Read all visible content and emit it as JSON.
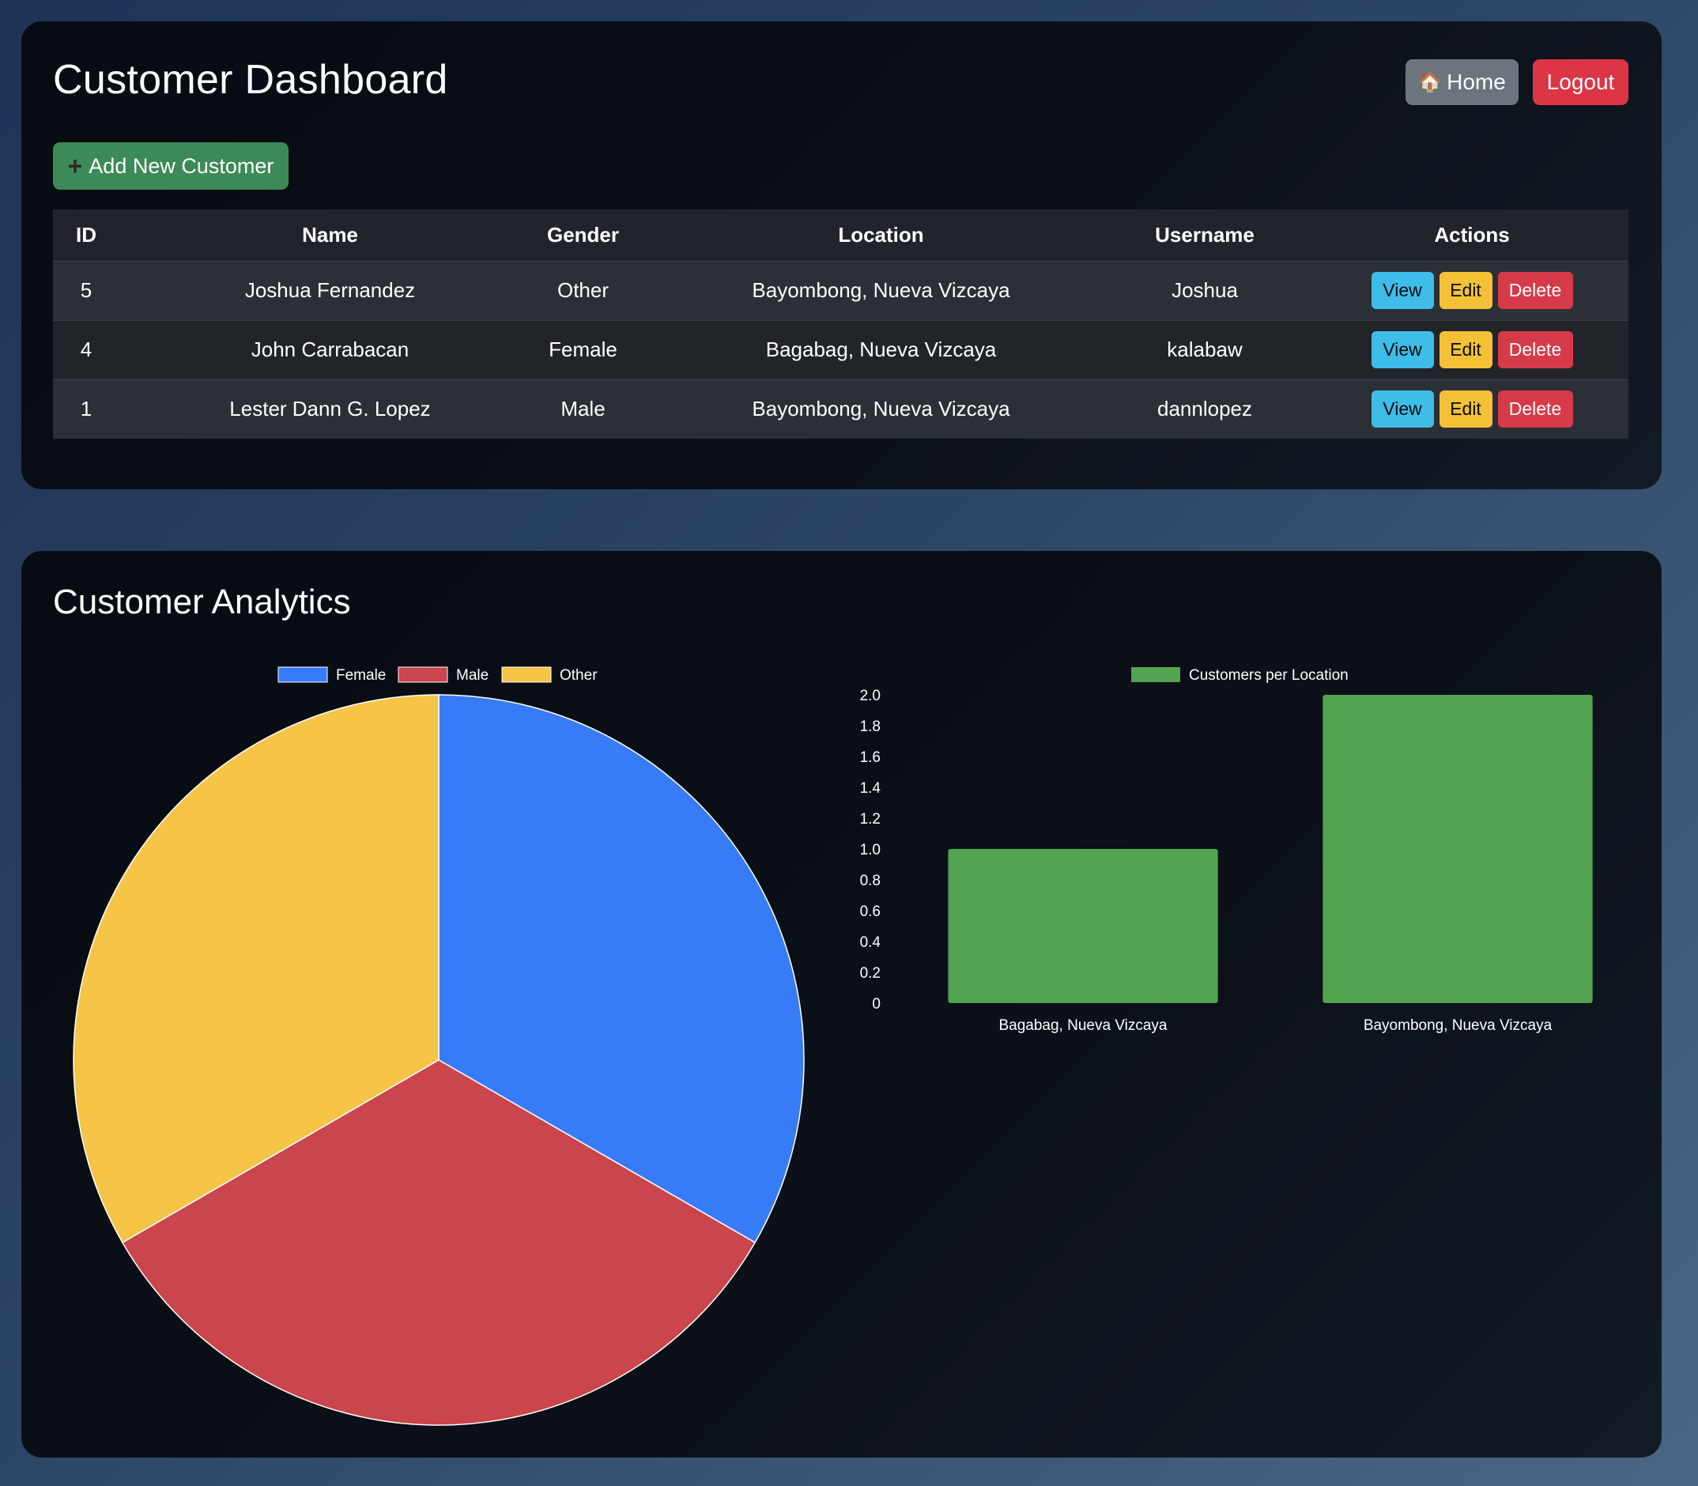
{
  "dashboard": {
    "title": "Customer Dashboard",
    "home_label": "Home",
    "home_icon": "🏠",
    "logout_label": "Logout",
    "add_label": "Add New Customer",
    "add_icon": "+"
  },
  "table": {
    "headers": [
      "ID",
      "Name",
      "Gender",
      "Location",
      "Username",
      "Actions"
    ],
    "action_labels": {
      "view": "View",
      "edit": "Edit",
      "delete": "Delete"
    },
    "rows": [
      {
        "id": "5",
        "name": "Joshua Fernandez",
        "gender": "Other",
        "location": "Bayombong, Nueva Vizcaya",
        "username": "Joshua"
      },
      {
        "id": "4",
        "name": "John Carrabacan",
        "gender": "Female",
        "location": "Bagabag, Nueva Vizcaya",
        "username": "kalabaw"
      },
      {
        "id": "1",
        "name": "Lester Dann G. Lopez",
        "gender": "Male",
        "location": "Bayombong, Nueva Vizcaya",
        "username": "dannlopez"
      }
    ]
  },
  "analytics": {
    "title": "Customer Analytics"
  },
  "colors": {
    "female": "#377cf6",
    "male": "#cb454c",
    "other": "#f6c446",
    "bar": "#52a450"
  },
  "chart_data": [
    {
      "type": "pie",
      "labels": [
        "Female",
        "Male",
        "Other"
      ],
      "values": [
        1,
        1,
        1
      ],
      "legend": "top"
    },
    {
      "type": "bar",
      "categories": [
        "Bagabag, Nueva Vizcaya",
        "Bayombong, Nueva Vizcaya"
      ],
      "series": [
        {
          "name": "Customers per Location",
          "values": [
            1,
            2
          ]
        }
      ],
      "ylim": [
        0,
        2
      ],
      "yticks": [
        "0",
        "0.2",
        "0.4",
        "0.6",
        "0.8",
        "1.0",
        "1.2",
        "1.4",
        "1.6",
        "1.8",
        "2.0"
      ],
      "legend": "top"
    }
  ]
}
